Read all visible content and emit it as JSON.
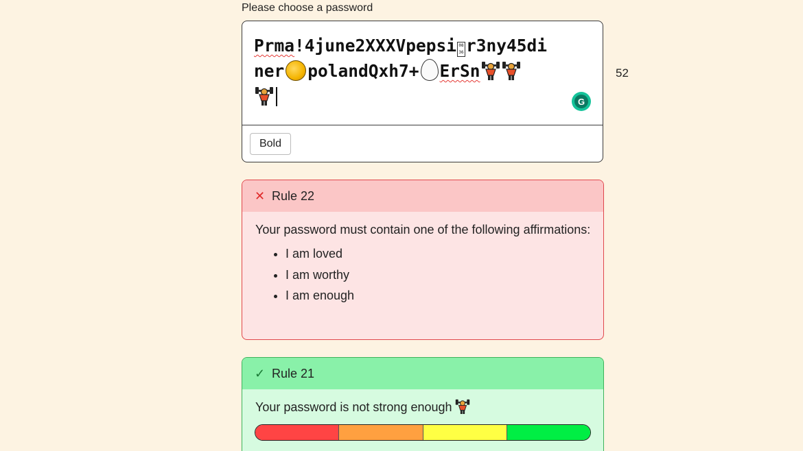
{
  "prompt_label": "Please choose a password",
  "password": {
    "line1_a": "Prma",
    "line1_b": "!4june2XXXVpepsi",
    "line1_c": "r3ny45di",
    "line2_a": "ner",
    "line2_b": "polandQxh7+",
    "line2_c": "ErSn",
    "glyph_box_text": "08\n36"
  },
  "char_count": "52",
  "toolbar": {
    "bold_label": "Bold"
  },
  "rules": [
    {
      "title": "Rule 22",
      "status": "fail",
      "description": "Your password must contain one of the following affirmations:",
      "items": [
        "I am loved",
        "I am worthy",
        "I am enough"
      ]
    },
    {
      "title": "Rule 21",
      "status": "pass",
      "description": "Your password is not strong enough",
      "strength_colors": [
        "#ff4444",
        "#ffa040",
        "#ffff44",
        "#00ee44"
      ]
    }
  ],
  "icons": {
    "fail": "x-icon",
    "pass": "check-icon",
    "emoji": [
      "full-moon-icon",
      "egg-icon",
      "weightlifter-icon"
    ]
  }
}
